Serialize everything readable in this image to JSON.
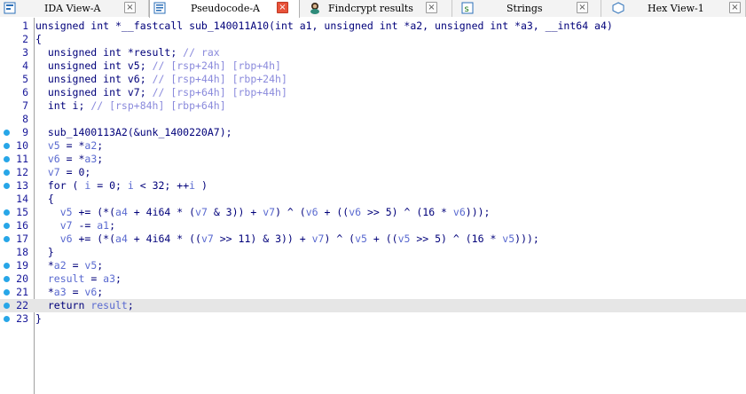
{
  "tabs": [
    {
      "label": "IDA View-A",
      "icon": "ida-view-icon",
      "active": false
    },
    {
      "label": "Pseudocode-A",
      "icon": "pseudocode-icon",
      "active": true
    },
    {
      "label": "Findcrypt results",
      "icon": "findcrypt-icon",
      "active": false
    },
    {
      "label": "Strings",
      "icon": "strings-icon",
      "active": false
    },
    {
      "label": "Hex View-1",
      "icon": "hex-view-icon",
      "active": false
    }
  ],
  "close_glyph": "×",
  "highlighted_line": 22,
  "breakpoint_lines": [
    9,
    10,
    11,
    12,
    13,
    15,
    16,
    17,
    19,
    20,
    21,
    22,
    23
  ],
  "colors": {
    "keyword": "#00007a",
    "variable": "#5a6ad0",
    "comment": "#8a8adc",
    "dot": "#27a6e8",
    "active_close": "#e8523a"
  },
  "lines": [
    {
      "n": 1,
      "t": [
        [
          "kw",
          "unsigned int *__fastcall sub_140011A10(int a1, unsigned int *a2, unsigned int *a3, __int64 a4)"
        ]
      ]
    },
    {
      "n": 2,
      "t": [
        [
          "kw",
          "{"
        ]
      ]
    },
    {
      "n": 3,
      "t": [
        [
          "kw",
          "  unsigned int *result; "
        ],
        [
          "cmt",
          "// rax"
        ]
      ]
    },
    {
      "n": 4,
      "t": [
        [
          "kw",
          "  unsigned int v5; "
        ],
        [
          "cmt",
          "// [rsp+24h] [rbp+4h]"
        ]
      ]
    },
    {
      "n": 5,
      "t": [
        [
          "kw",
          "  unsigned int v6; "
        ],
        [
          "cmt",
          "// [rsp+44h] [rbp+24h]"
        ]
      ]
    },
    {
      "n": 6,
      "t": [
        [
          "kw",
          "  unsigned int v7; "
        ],
        [
          "cmt",
          "// [rsp+64h] [rbp+44h]"
        ]
      ]
    },
    {
      "n": 7,
      "t": [
        [
          "kw",
          "  int i; "
        ],
        [
          "cmt",
          "// [rsp+84h] [rbp+64h]"
        ]
      ]
    },
    {
      "n": 8,
      "t": []
    },
    {
      "n": 9,
      "t": [
        [
          "kw",
          "  sub_1400113A2(&unk_1400220A7);"
        ]
      ]
    },
    {
      "n": 10,
      "t": [
        [
          "var",
          "  v5"
        ],
        [
          "kw",
          " = *"
        ],
        [
          "var",
          "a2"
        ],
        [
          "kw",
          ";"
        ]
      ]
    },
    {
      "n": 11,
      "t": [
        [
          "var",
          "  v6"
        ],
        [
          "kw",
          " = *"
        ],
        [
          "var",
          "a3"
        ],
        [
          "kw",
          ";"
        ]
      ]
    },
    {
      "n": 12,
      "t": [
        [
          "var",
          "  v7"
        ],
        [
          "kw",
          " = 0;"
        ]
      ]
    },
    {
      "n": 13,
      "t": [
        [
          "kw",
          "  for ( "
        ],
        [
          "var",
          "i"
        ],
        [
          "kw",
          " = 0; "
        ],
        [
          "var",
          "i"
        ],
        [
          "kw",
          " < 32; ++"
        ],
        [
          "var",
          "i"
        ],
        [
          "kw",
          " )"
        ]
      ]
    },
    {
      "n": 14,
      "t": [
        [
          "kw",
          "  {"
        ]
      ]
    },
    {
      "n": 15,
      "t": [
        [
          "var",
          "    v5"
        ],
        [
          "kw",
          " += (*("
        ],
        [
          "var",
          "a4"
        ],
        [
          "kw",
          " + 4i64 * ("
        ],
        [
          "var",
          "v7"
        ],
        [
          "kw",
          " & 3)) + "
        ],
        [
          "var",
          "v7"
        ],
        [
          "kw",
          ") ^ ("
        ],
        [
          "var",
          "v6"
        ],
        [
          "kw",
          " + (("
        ],
        [
          "var",
          "v6"
        ],
        [
          "kw",
          " >> 5) ^ (16 * "
        ],
        [
          "var",
          "v6"
        ],
        [
          "kw",
          ")));"
        ]
      ]
    },
    {
      "n": 16,
      "t": [
        [
          "var",
          "    v7"
        ],
        [
          "kw",
          " -= "
        ],
        [
          "var",
          "a1"
        ],
        [
          "kw",
          ";"
        ]
      ]
    },
    {
      "n": 17,
      "t": [
        [
          "var",
          "    v6"
        ],
        [
          "kw",
          " += (*("
        ],
        [
          "var",
          "a4"
        ],
        [
          "kw",
          " + 4i64 * (("
        ],
        [
          "var",
          "v7"
        ],
        [
          "kw",
          " >> 11) & 3)) + "
        ],
        [
          "var",
          "v7"
        ],
        [
          "kw",
          ") ^ ("
        ],
        [
          "var",
          "v5"
        ],
        [
          "kw",
          " + (("
        ],
        [
          "var",
          "v5"
        ],
        [
          "kw",
          " >> 5) ^ (16 * "
        ],
        [
          "var",
          "v5"
        ],
        [
          "kw",
          ")));"
        ]
      ]
    },
    {
      "n": 18,
      "t": [
        [
          "kw",
          "  }"
        ]
      ]
    },
    {
      "n": 19,
      "t": [
        [
          "kw",
          "  *"
        ],
        [
          "var",
          "a2"
        ],
        [
          "kw",
          " = "
        ],
        [
          "var",
          "v5"
        ],
        [
          "kw",
          ";"
        ]
      ]
    },
    {
      "n": 20,
      "t": [
        [
          "var",
          "  result"
        ],
        [
          "kw",
          " = "
        ],
        [
          "var",
          "a3"
        ],
        [
          "kw",
          ";"
        ]
      ]
    },
    {
      "n": 21,
      "t": [
        [
          "kw",
          "  *"
        ],
        [
          "var",
          "a3"
        ],
        [
          "kw",
          " = "
        ],
        [
          "var",
          "v6"
        ],
        [
          "kw",
          ";"
        ]
      ]
    },
    {
      "n": 22,
      "t": [
        [
          "kw",
          "  return "
        ],
        [
          "var",
          "result"
        ],
        [
          "kw",
          ";"
        ]
      ]
    },
    {
      "n": 23,
      "t": [
        [
          "kw",
          "}"
        ]
      ]
    }
  ]
}
